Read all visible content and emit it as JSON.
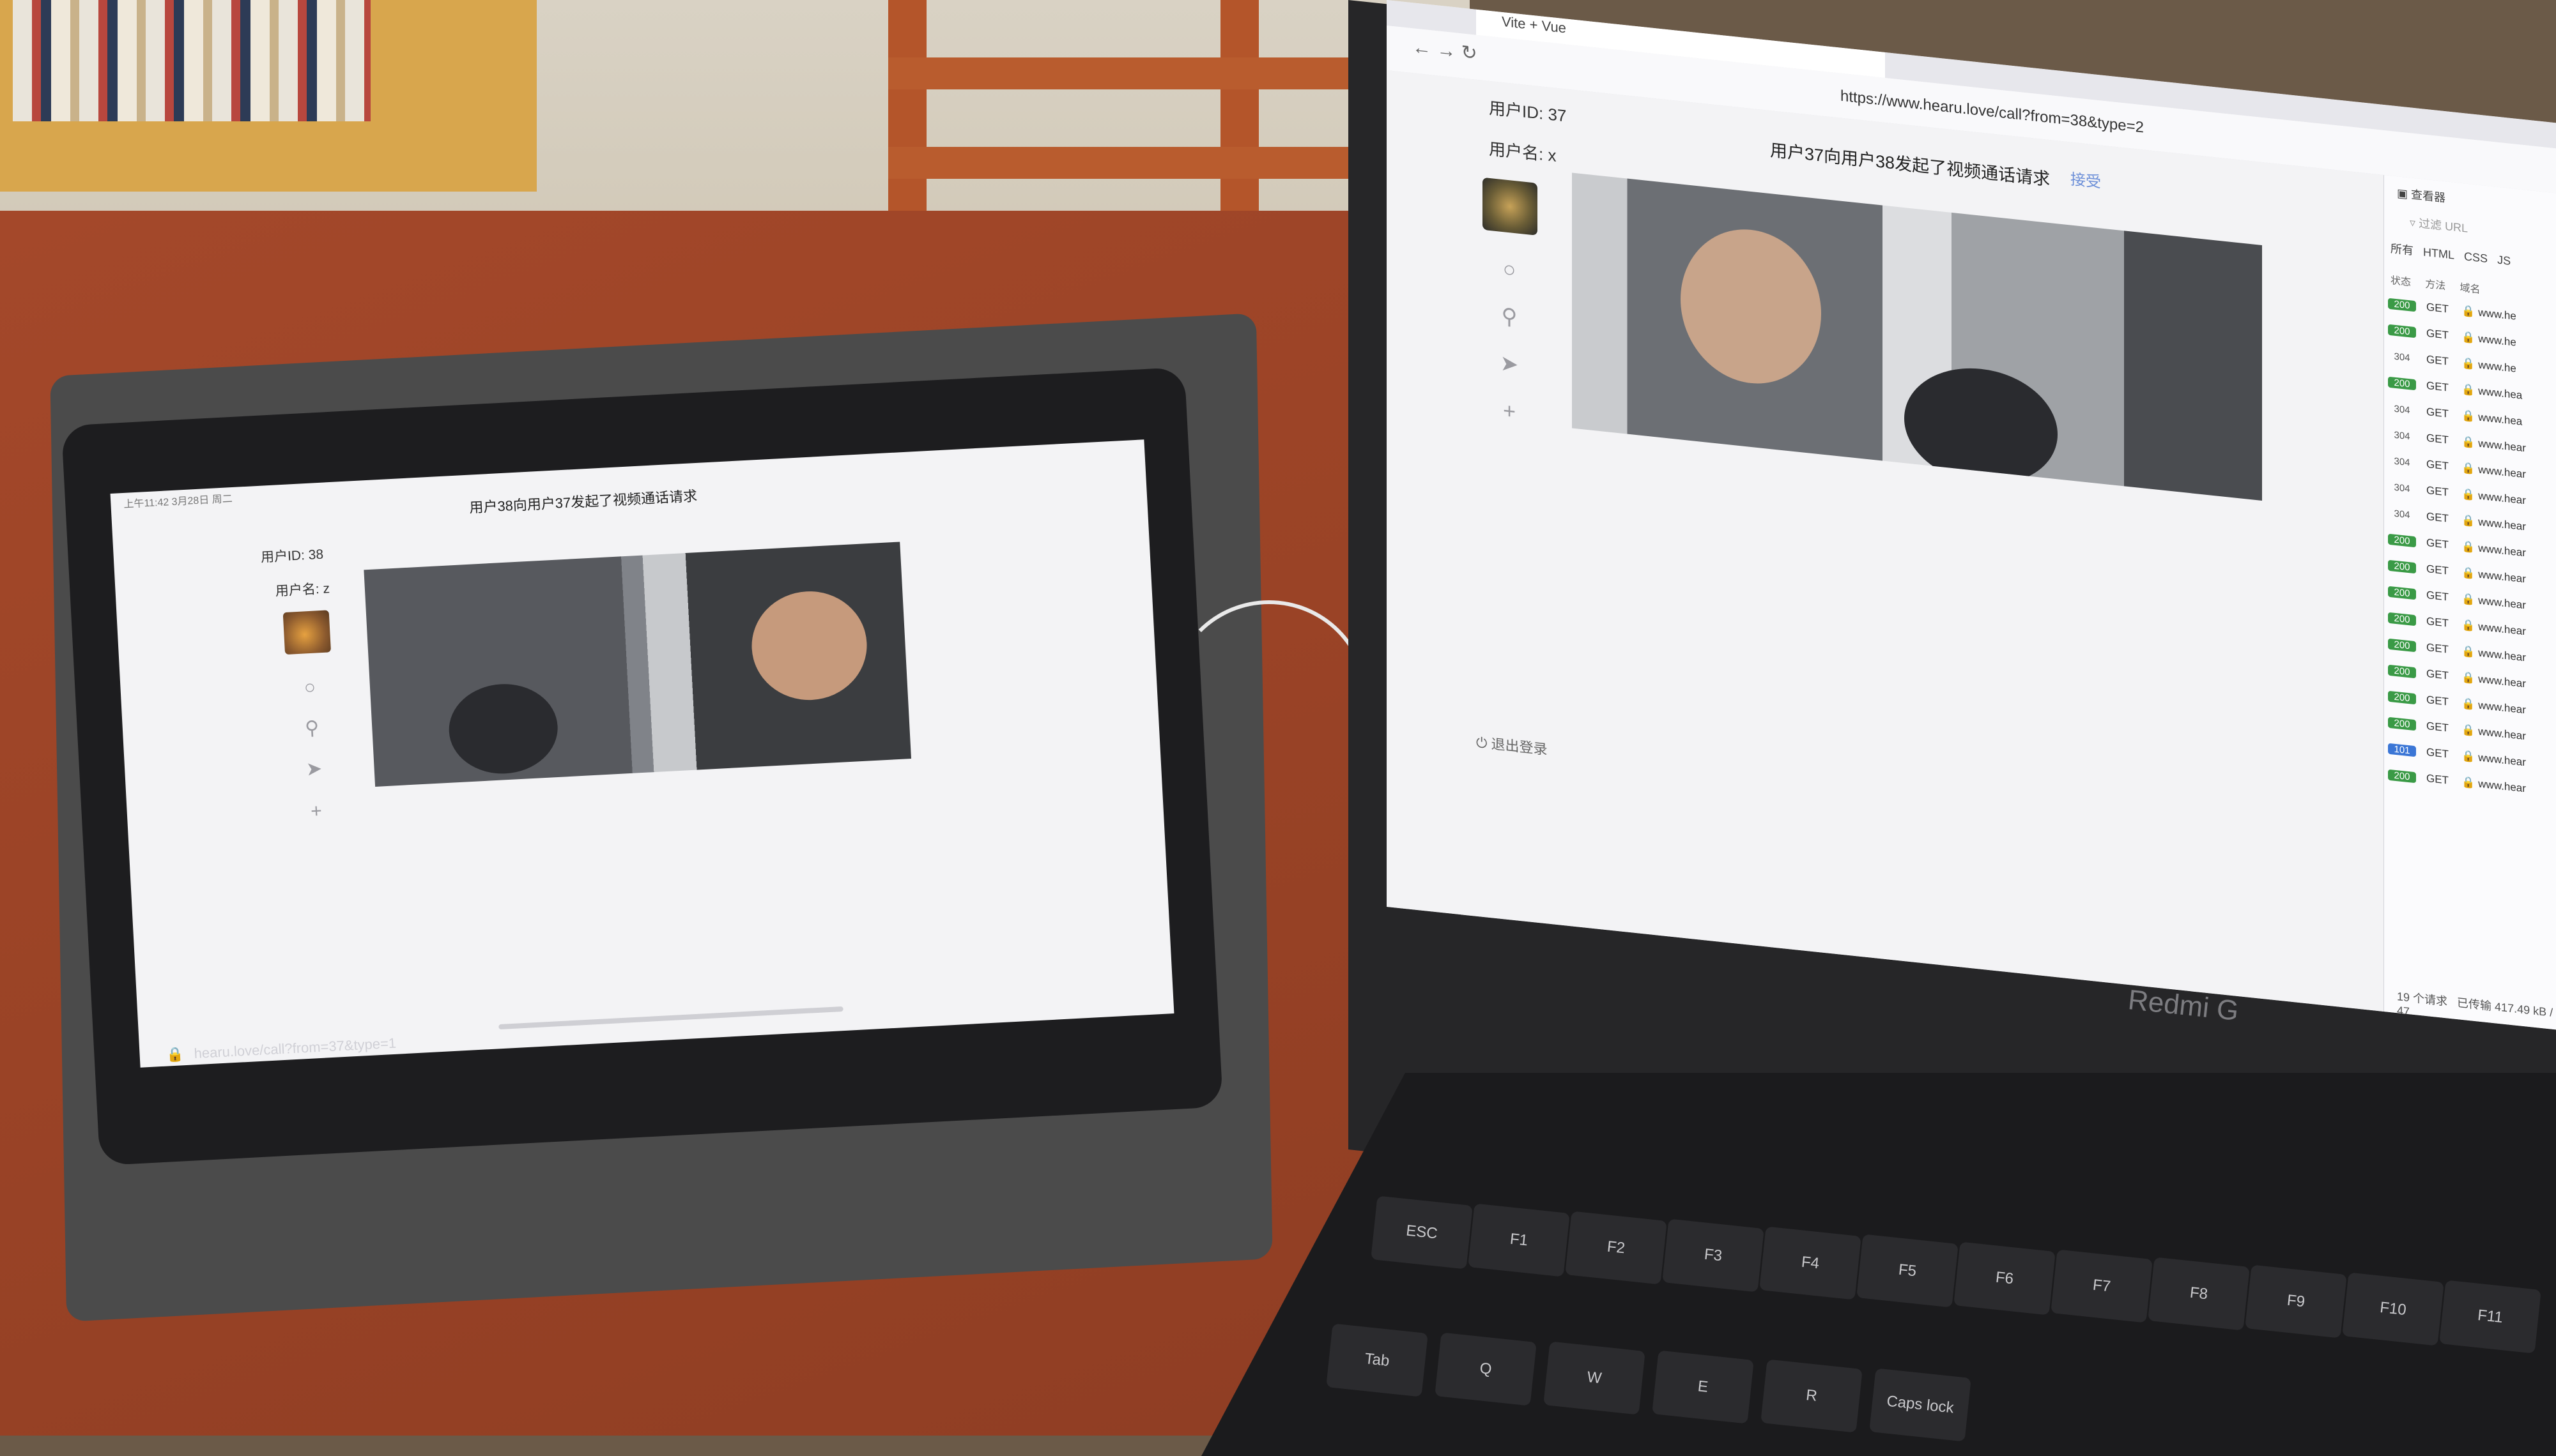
{
  "tablet": {
    "status_bar": "上午11:42 3月28日 周二",
    "title": "用户38向用户37发起了视频通话请求",
    "user_id": "用户ID: 38",
    "user_name": "用户名: z",
    "url": "hearu.love/call?from=37&type=1",
    "icons": [
      "chat-icon",
      "user-icon",
      "send-icon",
      "plus-icon"
    ]
  },
  "laptop": {
    "tab_title": "Vite + Vue",
    "url": "https://www.hearu.love/call?from=38&type=2",
    "title": "用户37向用户38发起了视频通话请求",
    "accept_label": "接受",
    "user_id": "用户ID: 37",
    "user_name": "用户名: x",
    "logout_label": "退出登录",
    "icons": [
      "chat-icon",
      "user-icon",
      "send-icon",
      "plus-icon"
    ],
    "brand": "Redmi G"
  },
  "devtools": {
    "inspector_label": "查看器",
    "filter_placeholder": "过滤 URL",
    "tabs": [
      "所有",
      "HTML",
      "CSS",
      "JS"
    ],
    "columns": [
      "状态",
      "方法",
      "域名"
    ],
    "rows": [
      {
        "status": "200",
        "method": "GET",
        "domain": "www.he"
      },
      {
        "status": "200",
        "method": "GET",
        "domain": "www.he"
      },
      {
        "status": "304",
        "method": "GET",
        "domain": "www.he"
      },
      {
        "status": "200",
        "method": "GET",
        "domain": "www.hea"
      },
      {
        "status": "304",
        "method": "GET",
        "domain": "www.hea"
      },
      {
        "status": "304",
        "method": "GET",
        "domain": "www.hear"
      },
      {
        "status": "304",
        "method": "GET",
        "domain": "www.hear"
      },
      {
        "status": "304",
        "method": "GET",
        "domain": "www.hear"
      },
      {
        "status": "304",
        "method": "GET",
        "domain": "www.hear"
      },
      {
        "status": "200",
        "method": "GET",
        "domain": "www.hear"
      },
      {
        "status": "200",
        "method": "GET",
        "domain": "www.hear"
      },
      {
        "status": "200",
        "method": "GET",
        "domain": "www.hear"
      },
      {
        "status": "200",
        "method": "GET",
        "domain": "www.hear"
      },
      {
        "status": "200",
        "method": "GET",
        "domain": "www.hear"
      },
      {
        "status": "200",
        "method": "GET",
        "domain": "www.hear"
      },
      {
        "status": "200",
        "method": "GET",
        "domain": "www.hear"
      },
      {
        "status": "200",
        "method": "GET",
        "domain": "www.hear"
      },
      {
        "status": "101",
        "method": "GET",
        "domain": "www.hear"
      },
      {
        "status": "200",
        "method": "GET",
        "domain": "www.hear"
      }
    ],
    "request_count": "19 个请求",
    "transferred": "已传输 417.49 kB / 47"
  },
  "keyboard": {
    "keys": [
      "ESC",
      "F1",
      "F2",
      "F3",
      "F4",
      "F5",
      "F6",
      "F7",
      "F8",
      "F9",
      "F10",
      "F11",
      "Tab",
      "Q",
      "W",
      "E",
      "R",
      "Caps lock"
    ]
  }
}
